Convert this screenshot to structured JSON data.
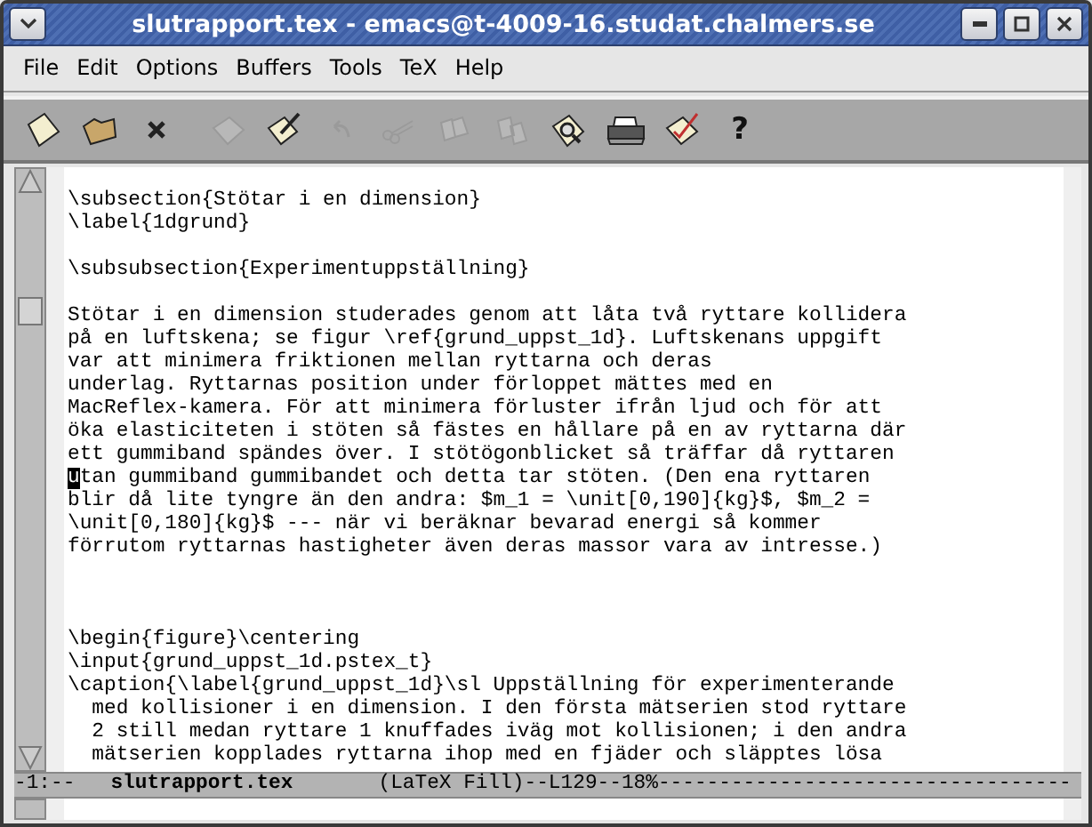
{
  "window": {
    "title": "slutrapport.tex - emacs@t-4009-16.studat.chalmers.se"
  },
  "menu": [
    "File",
    "Edit",
    "Options",
    "Buffers",
    "Tools",
    "TeX",
    "Help"
  ],
  "toolbar": [
    {
      "kind": "new",
      "disabled": false
    },
    {
      "kind": "open",
      "disabled": false
    },
    {
      "kind": "close",
      "disabled": false
    },
    {
      "kind": "save",
      "disabled": true
    },
    {
      "kind": "write",
      "disabled": false
    },
    {
      "kind": "undo",
      "disabled": true
    },
    {
      "kind": "cut",
      "disabled": true
    },
    {
      "kind": "copy",
      "disabled": true
    },
    {
      "kind": "paste",
      "disabled": true
    },
    {
      "kind": "search",
      "disabled": false
    },
    {
      "kind": "print",
      "disabled": false
    },
    {
      "kind": "spell",
      "disabled": false
    },
    {
      "kind": "help",
      "disabled": false,
      "label": "?"
    }
  ],
  "buffer": {
    "lines": [
      {
        "kind": "blank"
      },
      {
        "kind": "text",
        "text": "\\subsection{Stötar i en dimension}",
        "cursor": false
      },
      {
        "kind": "text",
        "text": "\\label{1dgrund}",
        "cursor": false
      },
      {
        "kind": "blank"
      },
      {
        "kind": "text",
        "text": "\\subsubsection{Experimentuppställning}",
        "cursor": false
      },
      {
        "kind": "blank"
      },
      {
        "kind": "text",
        "text": "Stötar i en dimension studerades genom att låta två ryttare kollidera",
        "cursor": false
      },
      {
        "kind": "text",
        "text": "på en luftskena; se figur \\ref{grund_uppst_1d}. Luftskenans uppgift",
        "cursor": false
      },
      {
        "kind": "text",
        "text": "var att minimera friktionen mellan ryttarna och deras",
        "cursor": false
      },
      {
        "kind": "text",
        "text": "underlag. Ryttarnas position under förloppet mättes med en",
        "cursor": false
      },
      {
        "kind": "text",
        "text": "MacReflex-kamera. För att minimera förluster ifrån ljud och för att",
        "cursor": false
      },
      {
        "kind": "text",
        "text": "öka elasticiteten i stöten så fästes en hållare på en av ryttarna där",
        "cursor": false
      },
      {
        "kind": "text",
        "text": "ett gummiband spändes över. I stötögonblicket så träffar då ryttaren",
        "cursor": false
      },
      {
        "kind": "text",
        "text": "utan gummiband gummibandet och detta tar stöten. (Den ena ryttaren",
        "cursor": true
      },
      {
        "kind": "text",
        "text": "blir då lite tyngre än den andra: $m_1 = \\unit[0,190]{kg}$, $m_2 =",
        "cursor": false
      },
      {
        "kind": "text",
        "text": "\\unit[0,180]{kg}$ --- när vi beräknar bevarad energi så kommer",
        "cursor": false
      },
      {
        "kind": "text",
        "text": "förrutom ryttarnas hastigheter även deras massor vara av intresse.)",
        "cursor": false
      },
      {
        "kind": "blank"
      },
      {
        "kind": "blank"
      },
      {
        "kind": "blank"
      },
      {
        "kind": "text",
        "text": "\\begin{figure}\\centering",
        "cursor": false
      },
      {
        "kind": "text",
        "text": "\\input{grund_uppst_1d.pstex_t}",
        "cursor": false
      },
      {
        "kind": "text",
        "text": "\\caption{\\label{grund_uppst_1d}\\sl Uppställning för experimenterande",
        "cursor": false
      },
      {
        "kind": "text",
        "text": "  med kollisioner i en dimension. I den första mätserien stod ryttare",
        "cursor": false
      },
      {
        "kind": "text",
        "text": "  2 still medan ryttare 1 knuffades iväg mot kollisionen; i den andra",
        "cursor": false
      },
      {
        "kind": "text",
        "text": "  mätserien kopplades ryttarna ihop med en fjäder och släpptes lösa",
        "cursor": false
      }
    ]
  },
  "mode_line": {
    "status": "-1:--",
    "buffer_name": "slutrapport.tex",
    "mode": "(LaTeX Fill)--L129--18%",
    "fill": "----------------------------------"
  }
}
